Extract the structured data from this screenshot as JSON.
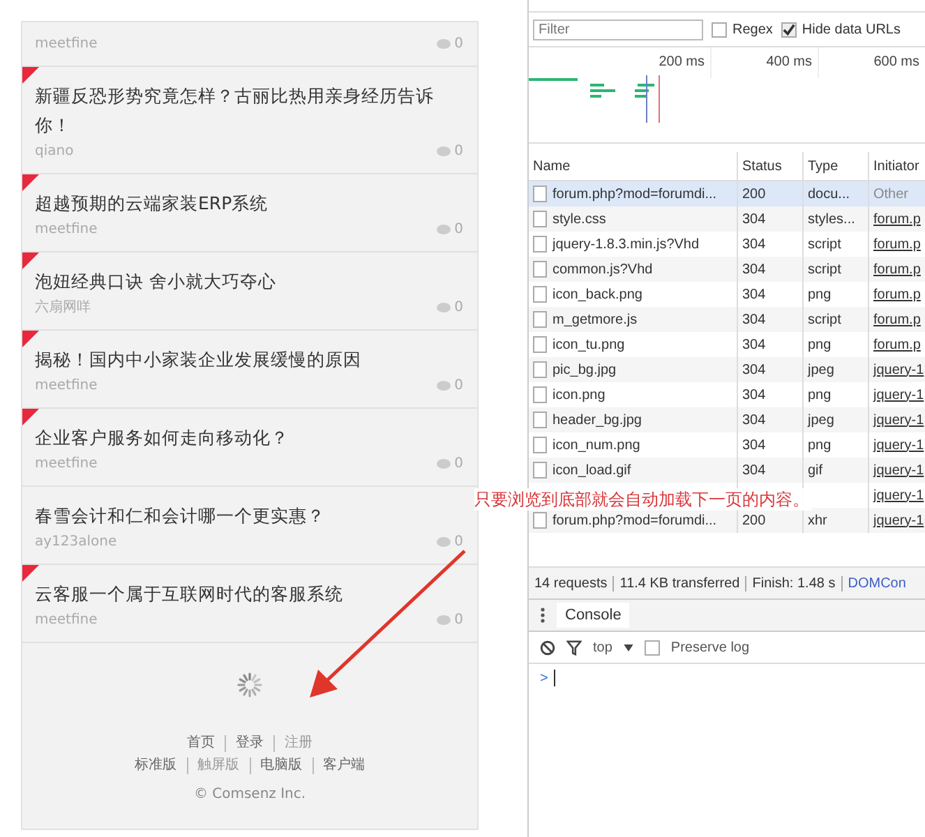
{
  "posts": [
    {
      "author": "meetfine",
      "comments": "0",
      "hot": false
    },
    {
      "title": "新疆反恐形势究竟怎样？古丽比热用亲身经历告诉你！",
      "author": "qiano",
      "comments": "0",
      "hot": true
    },
    {
      "title": "超越预期的云端家装ERP系统",
      "author": "meetfine",
      "comments": "0",
      "hot": true
    },
    {
      "title": "泡妞经典口诀 舍小就大巧夺心",
      "author": "六扇网咩",
      "comments": "0",
      "hot": true
    },
    {
      "title": "揭秘！国内中小家装企业发展缓慢的原因",
      "author": "meetfine",
      "comments": "0",
      "hot": true
    },
    {
      "title": "企业客户服务如何走向移动化？",
      "author": "meetfine",
      "comments": "0",
      "hot": true
    },
    {
      "title": "春雪会计和仁和会计哪一个更实惠？",
      "author": "ay123alone",
      "comments": "0",
      "hot": false
    },
    {
      "title": "云客服一个属于互联网时代的客服系统",
      "author": "meetfine",
      "comments": "0",
      "hot": true
    }
  ],
  "footer": {
    "links": [
      [
        {
          "label": "首页",
          "disabled": false
        },
        {
          "label": "登录",
          "disabled": false
        },
        {
          "label": "注册",
          "disabled": true
        }
      ],
      [
        {
          "label": "标准版",
          "disabled": false
        },
        {
          "label": "触屏版",
          "disabled": true
        },
        {
          "label": "电脑版",
          "disabled": false
        },
        {
          "label": "客户端",
          "disabled": false
        }
      ]
    ],
    "copyright": "© Comsenz Inc."
  },
  "devtools": {
    "filter": {
      "placeholder": "Filter"
    },
    "options": [
      {
        "label": "Regex",
        "checked": false
      },
      {
        "label": "Hide data URLs",
        "checked": true
      }
    ],
    "timeline_ticks": [
      "200 ms",
      "400 ms",
      "600 ms"
    ],
    "columns": [
      "Name",
      "Status",
      "Type",
      "Initiator"
    ],
    "rows": [
      {
        "name": "forum.php?mod=forumdi...",
        "status": "200",
        "type": "docu...",
        "initiator": "Other",
        "link": false,
        "selected": true
      },
      {
        "name": "style.css",
        "status": "304",
        "type": "styles...",
        "initiator": "forum.p",
        "link": true,
        "selected": false
      },
      {
        "name": "jquery-1.8.3.min.js?Vhd",
        "status": "304",
        "type": "script",
        "initiator": "forum.p",
        "link": true,
        "selected": false
      },
      {
        "name": "common.js?Vhd",
        "status": "304",
        "type": "script",
        "initiator": "forum.p",
        "link": true,
        "selected": false
      },
      {
        "name": "icon_back.png",
        "status": "304",
        "type": "png",
        "initiator": "forum.p",
        "link": true,
        "selected": false
      },
      {
        "name": "m_getmore.js",
        "status": "304",
        "type": "script",
        "initiator": "forum.p",
        "link": true,
        "selected": false
      },
      {
        "name": "icon_tu.png",
        "status": "304",
        "type": "png",
        "initiator": "forum.p",
        "link": true,
        "selected": false
      },
      {
        "name": "pic_bg.jpg",
        "status": "304",
        "type": "jpeg",
        "initiator": "jquery-1",
        "link": true,
        "selected": false
      },
      {
        "name": "icon.png",
        "status": "304",
        "type": "png",
        "initiator": "jquery-1",
        "link": true,
        "selected": false
      },
      {
        "name": "header_bg.jpg",
        "status": "304",
        "type": "jpeg",
        "initiator": "jquery-1",
        "link": true,
        "selected": false
      },
      {
        "name": "icon_num.png",
        "status": "304",
        "type": "png",
        "initiator": "jquery-1",
        "link": true,
        "selected": false
      },
      {
        "name": "icon_load.gif",
        "status": "304",
        "type": "gif",
        "initiator": "jquery-1",
        "link": true,
        "selected": false
      },
      {
        "initiator": "jquery-1",
        "link": true,
        "selected": false
      },
      {
        "name": "forum.php?mod=forumdi...",
        "status": "200",
        "type": "xhr",
        "initiator": "jquery-1",
        "link": true,
        "selected": false
      }
    ],
    "summary": [
      "14 requests",
      "11.4 KB transferred",
      "Finish: 1.48 s",
      "DOMCon"
    ],
    "console_tab": "Console",
    "context": "top",
    "preserve_log": {
      "label": "Preserve log",
      "checked": false
    },
    "prompt": ">"
  },
  "annotation": "只要浏览到底部就会自动加载下一页的内容。"
}
